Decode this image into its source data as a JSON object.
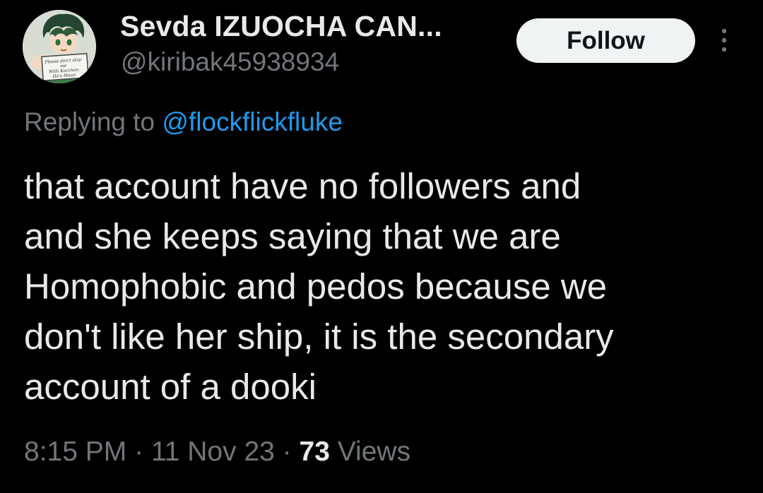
{
  "author": {
    "display_name": "Sevda IZUOCHA CAN...",
    "handle": "@kiribak45938934",
    "avatar_sign_lines": [
      "Please don't ship me",
      "With Kacchan",
      "He's Mean"
    ]
  },
  "follow_button": {
    "label": "Follow"
  },
  "more_menu": {
    "icon": "more-vertical-icon"
  },
  "reply_context": {
    "prefix": "Replying to",
    "mention": "@flockflickfluke"
  },
  "tweet": {
    "text_lines": [
      "that account have no followers and",
      "and she keeps saying that we are",
      "Homophobic and pedos because we",
      "don't like her ship, it is the secondary",
      "account of a dooki"
    ]
  },
  "meta": {
    "time": "8:15 PM",
    "separator": "·",
    "date": "11 Nov 23",
    "views_count": "73",
    "views_label": "Views"
  },
  "colors": {
    "background": "#000000",
    "primary_text": "#e7e9ea",
    "secondary_text": "#71767b",
    "link": "#1d9bf0",
    "button_bg": "#eff3f4"
  }
}
